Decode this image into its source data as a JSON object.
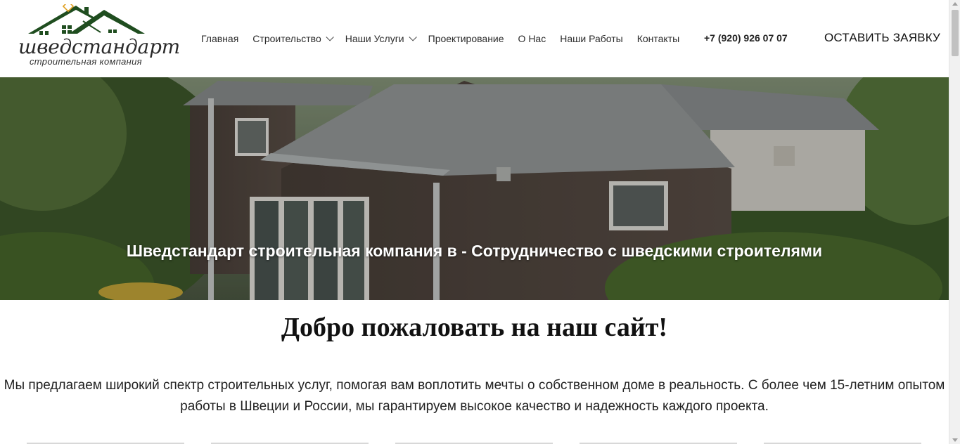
{
  "brand": {
    "name": "шведстандарт",
    "tagline": "строительная компания",
    "colors": {
      "roof": "#1f4d1f",
      "accent": "#e0a020"
    }
  },
  "nav": {
    "items": [
      {
        "label": "Главная",
        "has_dropdown": false
      },
      {
        "label": "Строительство",
        "has_dropdown": true
      },
      {
        "label": "Наши Услуги",
        "has_dropdown": true
      },
      {
        "label": "Проектирование",
        "has_dropdown": false
      },
      {
        "label": "О Нас",
        "has_dropdown": false
      },
      {
        "label": "Наши Работы",
        "has_dropdown": false
      },
      {
        "label": "Контакты",
        "has_dropdown": false
      }
    ]
  },
  "header": {
    "phone": "+7 (920) 926 07 07",
    "cta_label": "ОСТАВИТЬ ЗАЯВКУ"
  },
  "hero": {
    "title": "Шведстандарт строительная компания в - Сотрудничество с шведскими строителями",
    "image_icon": "wooden-house-photo"
  },
  "main": {
    "welcome": "Добро пожаловать на наш сайт!",
    "intro": "Мы предлагаем широкий спектр строительных услуг, помогая вам воплотить мечты о собственном доме в реальность. С более чем 15-летним опытом работы в Швеции и России, мы гарантируем высокое качество и надежность каждого проекта."
  }
}
